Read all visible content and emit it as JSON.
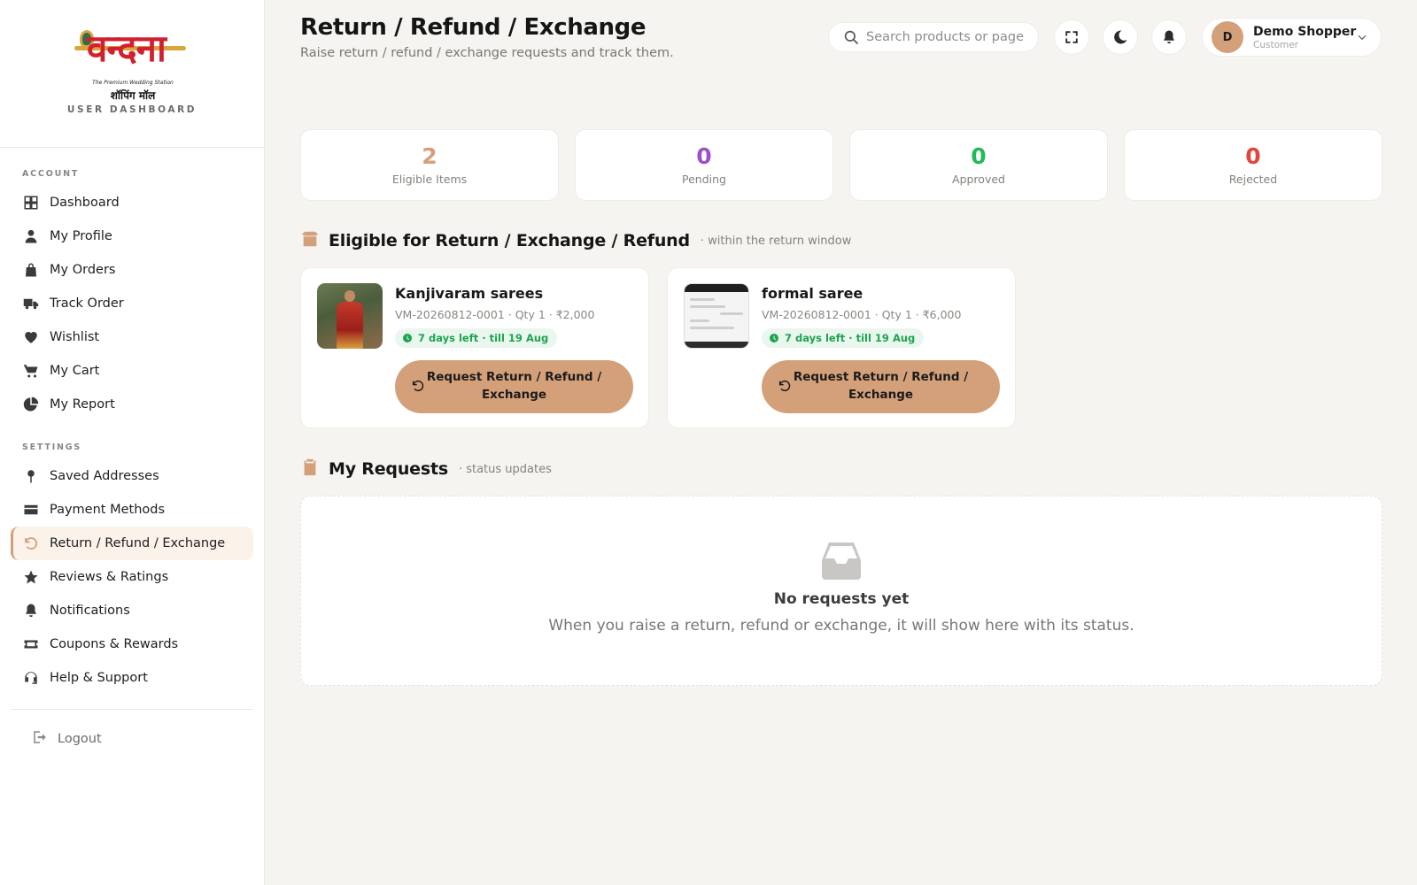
{
  "brand": {
    "logo_text": "वन्दना",
    "logo_tagline": "The Premium Wedding Station",
    "logo_subtitle": "शॉपिंग मॉल",
    "label": "USER DASHBOARD"
  },
  "sidebar": {
    "account_heading": "ACCOUNT",
    "settings_heading": "SETTINGS",
    "account_items": [
      {
        "label": "Dashboard",
        "icon": "grid-icon"
      },
      {
        "label": "My Profile",
        "icon": "user-icon"
      },
      {
        "label": "My Orders",
        "icon": "bag-icon"
      },
      {
        "label": "Track Order",
        "icon": "truck-icon"
      },
      {
        "label": "Wishlist",
        "icon": "heart-icon"
      },
      {
        "label": "My Cart",
        "icon": "cart-icon"
      },
      {
        "label": "My Report",
        "icon": "pie-chart-icon"
      }
    ],
    "settings_items": [
      {
        "label": "Saved Addresses",
        "icon": "pin-icon"
      },
      {
        "label": "Payment Methods",
        "icon": "credit-card-icon"
      },
      {
        "label": "Return / Refund / Exchange",
        "icon": "undo-icon",
        "active": true
      },
      {
        "label": "Reviews & Ratings",
        "icon": "star-icon"
      },
      {
        "label": "Notifications",
        "icon": "bell-icon"
      },
      {
        "label": "Coupons & Rewards",
        "icon": "ticket-icon"
      },
      {
        "label": "Help & Support",
        "icon": "headset-icon"
      }
    ],
    "logout_label": "Logout"
  },
  "header": {
    "title": "Return / Refund / Exchange",
    "subtitle": "Raise return / refund / exchange requests and track them.",
    "search_placeholder": "Search products or page",
    "user_initial": "D",
    "user_name": "Demo Shopper",
    "user_role": "Customer"
  },
  "stats": [
    {
      "value": "2",
      "label": "Eligible Items",
      "color": "#d4a07a"
    },
    {
      "value": "0",
      "label": "Pending",
      "color": "#9b51c8"
    },
    {
      "value": "0",
      "label": "Approved",
      "color": "#22b95a"
    },
    {
      "value": "0",
      "label": "Rejected",
      "color": "#e0463c"
    }
  ],
  "eligible": {
    "title": "Eligible for Return / Exchange / Refund",
    "hint": "· within the return window",
    "items": [
      {
        "name": "Kanjivaram sarees",
        "meta": "VM-20260812-0001 · Qty 1 · ₹2,000",
        "badge": "7 days left · till 19 Aug",
        "button": "Request Return / Refund / Exchange"
      },
      {
        "name": "formal saree",
        "meta": "VM-20260812-0001 · Qty 1 · ₹6,000",
        "badge": "7 days left · till 19 Aug",
        "button": "Request Return / Refund / Exchange"
      }
    ]
  },
  "requests": {
    "title": "My Requests",
    "hint": "· status updates",
    "empty_title": "No requests yet",
    "empty_text": "When you raise a return, refund or exchange, it will show here with its status."
  },
  "colors": {
    "accent": "#d4a07a",
    "success": "#1fa34f",
    "background": "#f5f4f1"
  }
}
